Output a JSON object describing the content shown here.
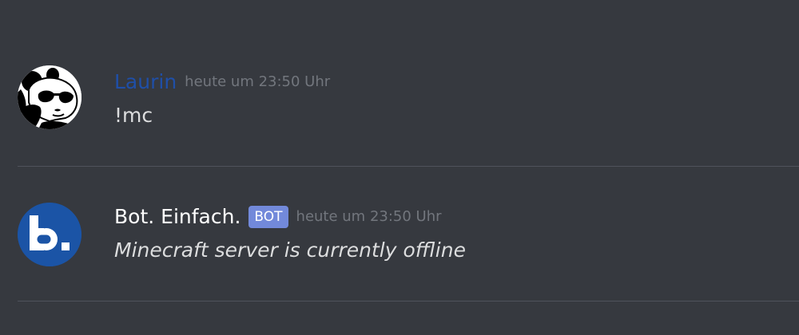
{
  "messages": [
    {
      "author": "Laurin",
      "timestamp": "heute um 23:50 Uhr",
      "text": "!mc",
      "author_color": "#1f4fa8",
      "avatar_icon": "panda-sunglasses-avatar-icon"
    },
    {
      "author": "Bot. Einfach.",
      "tag": "BOT",
      "timestamp": "heute um 23:50 Uhr",
      "text": "Minecraft server is currently offline",
      "author_color": "#ffffff",
      "tag_color": "#7289da",
      "avatar_icon": "bot-einfach-logo-icon"
    }
  ],
  "colors": {
    "background": "#36393f",
    "timestamp": "#72767d",
    "message_text": "#dcddde",
    "divider": "#4f535b"
  }
}
